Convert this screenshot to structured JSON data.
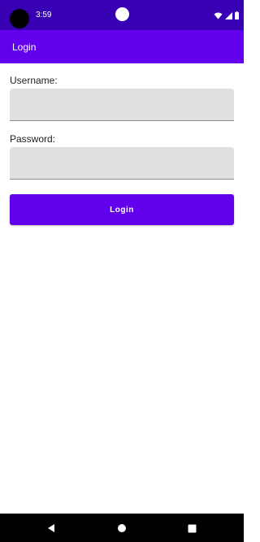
{
  "status_bar": {
    "time": "3:59",
    "icons": [
      "wifi-icon",
      "signal-icon",
      "battery-icon"
    ],
    "color": "#3700b3"
  },
  "app_bar": {
    "title": "Login",
    "color": "#6200ee"
  },
  "form": {
    "username": {
      "label": "Username:",
      "value": "",
      "placeholder": ""
    },
    "password": {
      "label": "Password:",
      "value": "",
      "placeholder": ""
    },
    "login_button": {
      "label": "Login",
      "color": "#6200ee"
    }
  },
  "nav_bar": {
    "buttons": [
      "back-icon",
      "home-icon",
      "recents-icon"
    ]
  }
}
